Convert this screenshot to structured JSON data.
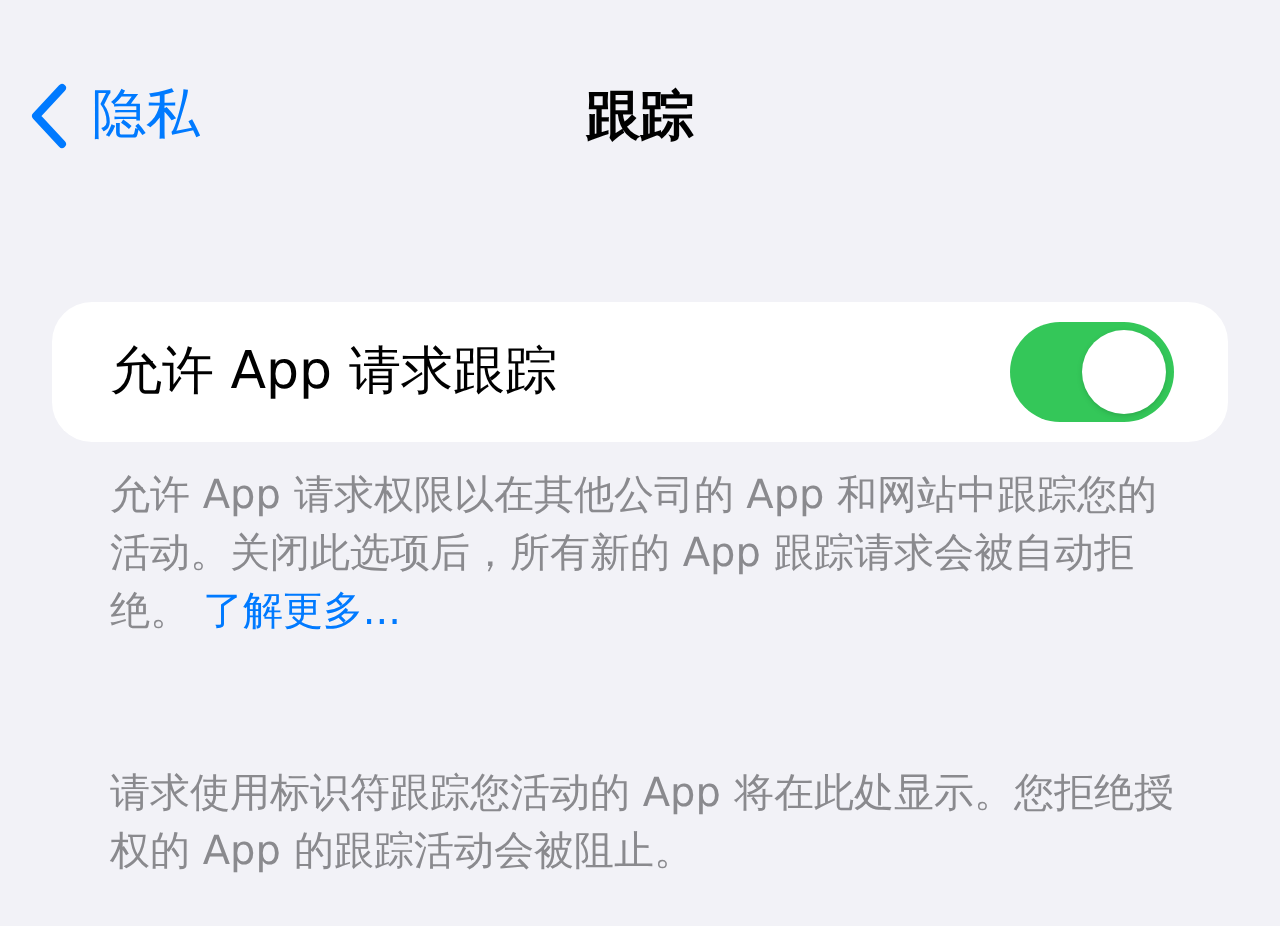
{
  "nav": {
    "back_label": "隐私",
    "title": "跟踪"
  },
  "settings": [
    {
      "label": "允许 App 请求跟踪",
      "on": true
    }
  ],
  "footer": {
    "text": "允许 App 请求权限以在其他公司的 App 和网站中跟踪您的活动。关闭此选项后，所有新的 App 跟踪请求会被自动拒绝。",
    "link": "了解更多..."
  },
  "note": "请求使用标识符跟踪您活动的 App 将在此处显示。您拒绝授权的 App 的跟踪活动会被阻止。"
}
